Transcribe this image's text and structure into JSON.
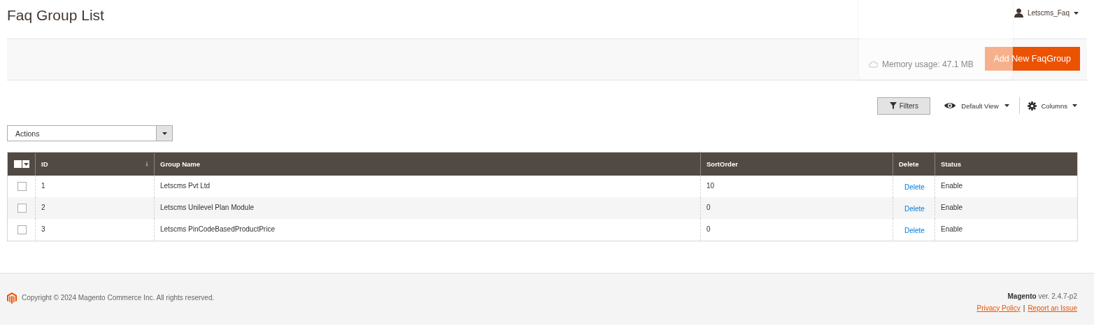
{
  "page_title": "Faq Group List",
  "user_menu": {
    "label": "Letscms_Faq"
  },
  "memory_notice": "Memory usage: 47.1 MB",
  "add_button": "Add New FaqGroup",
  "toolbar": {
    "filters": "Filters",
    "view": "Default View",
    "columns": "Columns"
  },
  "actions_select": {
    "value": "Actions"
  },
  "table": {
    "all_selected": false,
    "columns": [
      {
        "label": "ID",
        "sorted": true
      },
      {
        "label": "Group Name",
        "sorted": false
      },
      {
        "label": "SortOrder",
        "sorted": false
      },
      {
        "label": "Delete",
        "sorted": false
      },
      {
        "label": "Status",
        "sorted": false
      }
    ],
    "rows": [
      {
        "checked": false,
        "id": "1",
        "group_name": "Letscms Pvt Ltd",
        "sort_order": "10",
        "delete_link": "Delete",
        "status": "Enable"
      },
      {
        "checked": false,
        "id": "2",
        "group_name": "Letscms Unilevel Plan Module",
        "sort_order": "0",
        "delete_link": "Delete",
        "status": "Enable"
      },
      {
        "checked": false,
        "id": "3",
        "group_name": "Letscms PinCodeBasedProductPrice",
        "sort_order": "0",
        "delete_link": "Delete",
        "status": "Enable"
      }
    ]
  },
  "footer": {
    "copyright": "Copyright © 2024 Magento Commerce Inc. All rights reserved.",
    "brand": "Magento",
    "version": "ver. 2.4.7-p2",
    "links": [
      "Privacy Policy",
      "Report an Issue"
    ],
    "separator": "|"
  }
}
